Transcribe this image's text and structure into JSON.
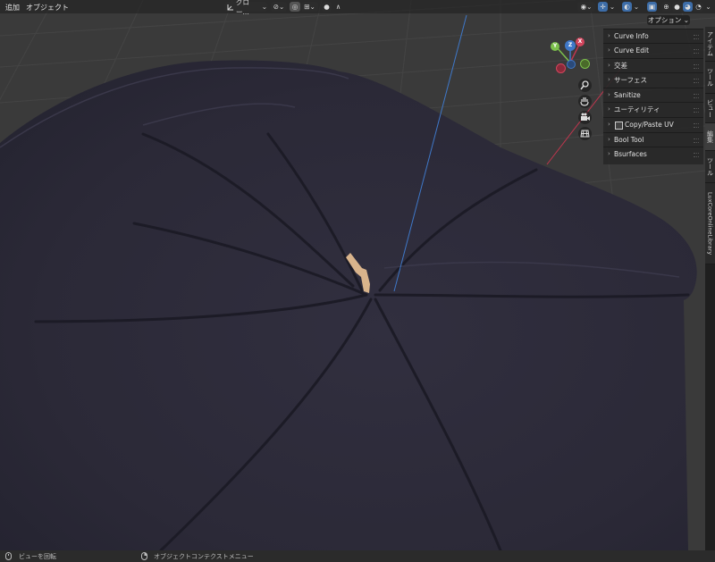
{
  "header": {
    "menu_add": "追加",
    "menu_object": "オブジェクト",
    "orientation_label": "グロー..."
  },
  "options_button": "オプション",
  "n_panel": {
    "items": [
      {
        "label": "Curve Info"
      },
      {
        "label": "Curve Edit"
      },
      {
        "label": "交差"
      },
      {
        "label": "サーフェス"
      },
      {
        "label": "Sanitize"
      },
      {
        "label": "ユーティリティ"
      },
      {
        "label": "Copy/Paste UV"
      },
      {
        "label": "Bool Tool"
      },
      {
        "label": "Bsurfaces"
      }
    ]
  },
  "tabs": [
    {
      "label": "アイテム"
    },
    {
      "label": "ツール"
    },
    {
      "label": "ビュー"
    },
    {
      "label": "編集"
    },
    {
      "label": "ツール"
    },
    {
      "label": "LuxCoreOnlineLibrary"
    }
  ],
  "gizmo": {
    "x_label": "X",
    "y_label": "Y",
    "z_label": "Z"
  },
  "status": {
    "left_hint": "ビューを回転",
    "right_hint": "オブジェクトコンテクストメニュー"
  },
  "colors": {
    "object": "#2c2a38",
    "grid_bg": "#3a3a3a",
    "axis_red": "#c0364e",
    "axis_blue": "#3f78c8",
    "sprout": "#d9b48c"
  }
}
